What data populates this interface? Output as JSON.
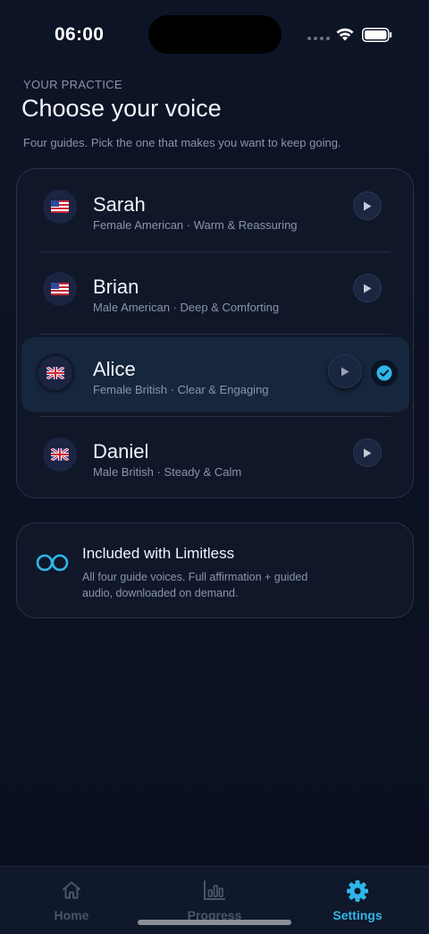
{
  "status_bar": {
    "time": "06:00"
  },
  "header": {
    "eyebrow": "YOUR PRACTICE",
    "title": "Choose your voice",
    "subtitle": "Four guides. Pick the one that makes you want to keep going."
  },
  "voices": [
    {
      "name": "Sarah",
      "description": "Female American · Warm & Reassuring",
      "flag": "us-flag-icon",
      "selected": false
    },
    {
      "name": "Brian",
      "description": "Male American · Deep & Comforting",
      "flag": "us-flag-icon",
      "selected": false
    },
    {
      "name": "Alice",
      "description": "Female British · Clear & Engaging",
      "flag": "uk-flag-icon",
      "selected": true
    },
    {
      "name": "Daniel",
      "description": "Male British · Steady & Calm",
      "flag": "uk-flag-icon",
      "selected": false
    }
  ],
  "limitless": {
    "title": "Included with Limitless",
    "description": "All four guide voices. Full affirmation + guided audio, downloaded on demand.",
    "icon": "infinity-icon"
  },
  "tabs": [
    {
      "label": "Home",
      "icon": "home-icon",
      "active": false
    },
    {
      "label": "Progress",
      "icon": "bar-chart-icon",
      "active": false
    },
    {
      "label": "Settings",
      "icon": "gear-icon",
      "active": true
    }
  ],
  "colors": {
    "accent": "#2fb6e8",
    "background": "#0b1120",
    "card": "#0f1729",
    "selected_row": "#16263d"
  }
}
